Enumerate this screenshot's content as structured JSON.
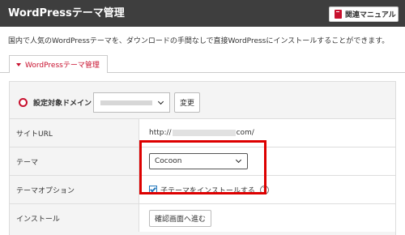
{
  "header": {
    "title": "WordPressテーマ管理",
    "manual_label": "関連マニュアル"
  },
  "description": "国内で人気のWordPressテーマを、ダウンロードの手間なしで直接WordPressにインストールすることができます。",
  "tab": {
    "label": "WordPressテーマ管理"
  },
  "domain": {
    "label": "設定対象ドメイン",
    "change_label": "変更"
  },
  "rows": {
    "site_url": {
      "label": "サイトURL",
      "prefix": "http://",
      "suffix": "com/"
    },
    "theme": {
      "label": "テーマ",
      "selected": "Cocoon"
    },
    "theme_option": {
      "label": "テーマオプション",
      "checkbox_label": "子テーマをインストールする",
      "checked": true,
      "help": "?"
    },
    "install": {
      "label": "インストール",
      "button_label": "確認画面へ進む"
    }
  },
  "colors": {
    "header_bg": "#3e3e3e",
    "accent_red": "#c8102e",
    "highlight": "#dd0000",
    "checkbox_blue": "#2277bb"
  },
  "icons": [
    "book-icon",
    "caret-icon",
    "radio-icon",
    "chevron-down-icon",
    "checkbox-check-icon",
    "help-icon"
  ]
}
